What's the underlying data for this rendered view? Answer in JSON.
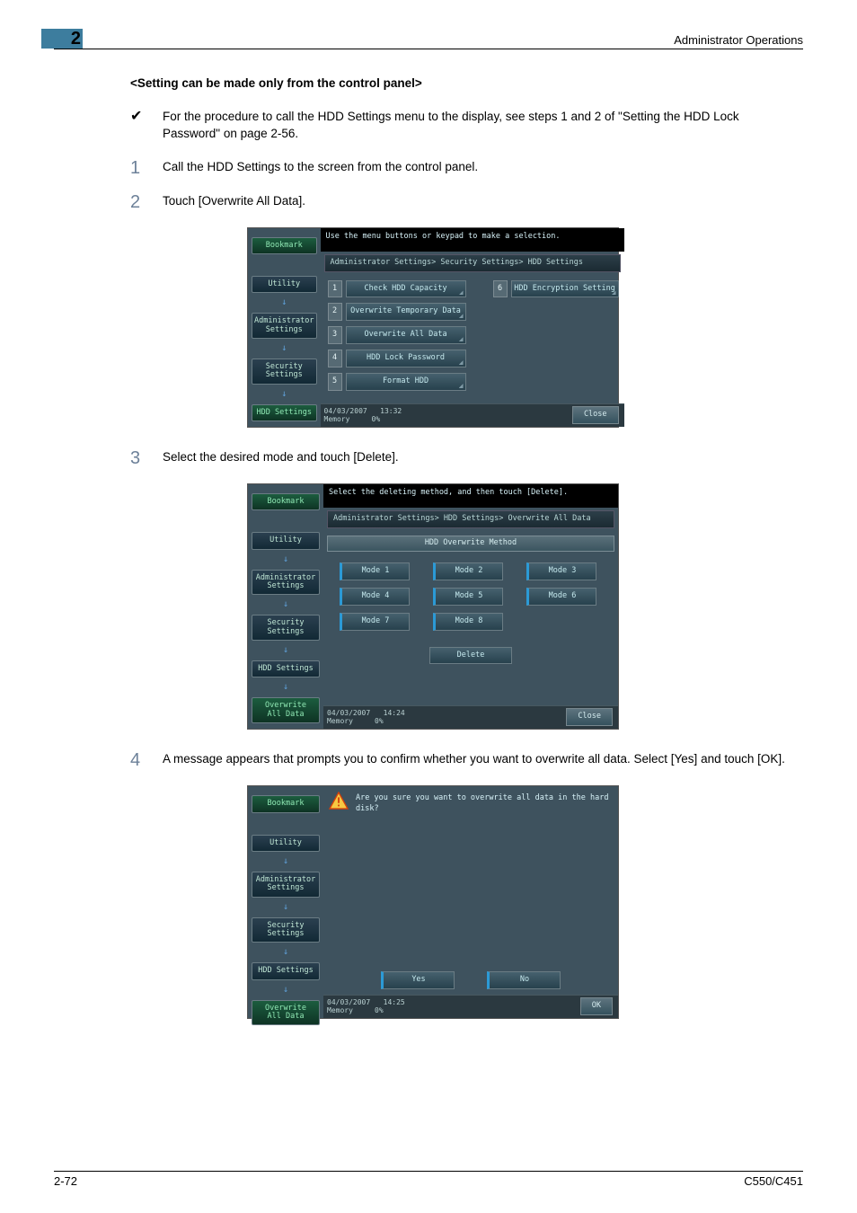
{
  "header": {
    "chapter": "2",
    "title": "Administrator Operations"
  },
  "section": {
    "heading": "<Setting can be made only from the control panel>"
  },
  "steps": {
    "prereq": "For the procedure to call the HDD Settings menu to the display, see steps 1 and 2 of \"Setting the HDD Lock Password\" on page 2-56.",
    "s1": {
      "num": "1",
      "text": "Call the HDD Settings to the screen from the control panel."
    },
    "s2": {
      "num": "2",
      "text": "Touch [Overwrite All Data]."
    },
    "s3": {
      "num": "3",
      "text": "Select the desired mode and touch [Delete]."
    },
    "s4": {
      "num": "4",
      "text": "A message appears that prompts you to confirm whether you want to overwrite all data. Select [Yes] and touch [OK]."
    }
  },
  "sidebar": {
    "bookmark": "Bookmark",
    "utility": "Utility",
    "admin": "Administrator\nSettings",
    "security": "Security\nSettings",
    "hdd": "HDD Settings",
    "overwrite": "Overwrite\nAll Data"
  },
  "panel1": {
    "msg": "Use the menu buttons or keypad to make a selection.",
    "crumb": "Administrator Settings> Security Settings> HDD Settings",
    "items": {
      "i1": {
        "n": "1",
        "label": "Check HDD Capacity"
      },
      "i2": {
        "n": "2",
        "label": "Overwrite Temporary Data"
      },
      "i3": {
        "n": "3",
        "label": "Overwrite All Data"
      },
      "i4": {
        "n": "4",
        "label": "HDD Lock Password"
      },
      "i5": {
        "n": "5",
        "label": "Format HDD"
      },
      "i6": {
        "n": "6",
        "label": "HDD Encryption Setting"
      }
    },
    "status": {
      "date": "04/03/2007",
      "time": "13:32",
      "mem": "Memory",
      "memval": "0%",
      "close": "Close"
    }
  },
  "panel2": {
    "msg": "Select the deleting method, and then touch [Delete].",
    "crumb": "Administrator Settings> HDD Settings> Overwrite All Data",
    "header": "HDD Overwrite Method",
    "modes": {
      "m1": "Mode 1",
      "m2": "Mode 2",
      "m3": "Mode 3",
      "m4": "Mode 4",
      "m5": "Mode 5",
      "m6": "Mode 6",
      "m7": "Mode 7",
      "m8": "Mode 8"
    },
    "delete": "Delete",
    "status": {
      "date": "04/03/2007",
      "time": "14:24",
      "mem": "Memory",
      "memval": "0%",
      "close": "Close"
    }
  },
  "panel3": {
    "msg": "Are you sure you want to overwrite all data in the hard disk?",
    "yes": "Yes",
    "no": "No",
    "status": {
      "date": "04/03/2007",
      "time": "14:25",
      "mem": "Memory",
      "memval": "0%",
      "ok": "OK"
    }
  },
  "footer": {
    "left": "2-72",
    "right": "C550/C451"
  }
}
